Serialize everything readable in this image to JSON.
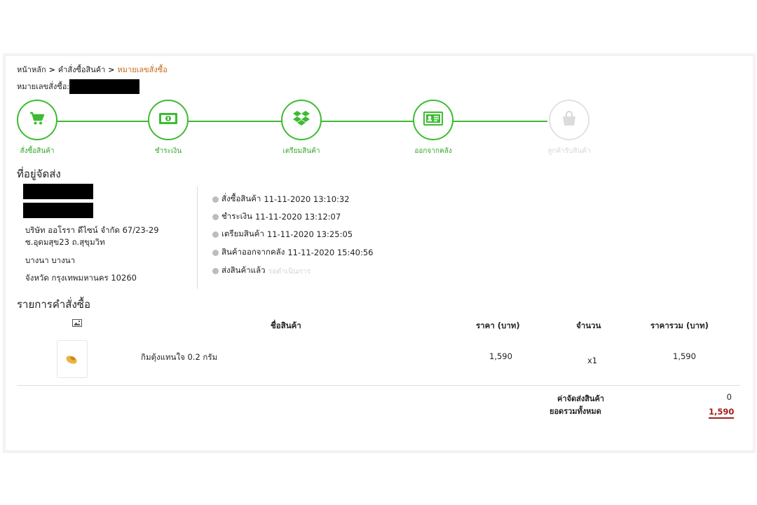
{
  "breadcrumb": {
    "items": [
      "หน้าหลัก",
      "คำสั่งซื้อสินค้า",
      "หมายเลขสั่งซื้อ"
    ],
    "separator": ">"
  },
  "order": {
    "number_label": "หมายเลขสั่งซื้อ:"
  },
  "steps": [
    {
      "label": "สั่งซื้อสินค้า",
      "icon": "cart-icon",
      "active": true
    },
    {
      "label": "ชำระเงิน",
      "icon": "money-icon",
      "active": true
    },
    {
      "label": "เตรียมสินค้า",
      "icon": "box-icon",
      "active": true
    },
    {
      "label": "ออกจากคลัง",
      "icon": "id-card-icon",
      "active": true
    },
    {
      "label": "ลูกค้ารับสินค้า",
      "icon": "bag-icon",
      "active": false
    }
  ],
  "shipping": {
    "heading": "ที่อยู่จัดส่ง",
    "address_lines": [
      "บริษัท ออโรรา ดีไซน์ จำกัด 67/23-29",
      "ซ.อุดมสุข23 ถ.สุขุมวิท",
      "บางนา บางนา",
      "จังหวัด กรุงเทพมหานคร 10260"
    ]
  },
  "timeline": [
    {
      "label": "สั่งซื้อสินค้า",
      "time": "11-11-2020 13:10:32"
    },
    {
      "label": "ชำระเงิน",
      "time": "11-11-2020 13:12:07"
    },
    {
      "label": "เตรียมสินค้า",
      "time": "11-11-2020 13:25:05"
    },
    {
      "label": "สินค้าออกจากคลัง",
      "time": "11-11-2020 15:40:56"
    },
    {
      "label": "ส่งสินค้าแล้ว",
      "time": "รอดำเนินการ"
    }
  ],
  "items_section": {
    "heading": "รายการคำสั่งซื้อ",
    "columns": {
      "image": "image-icon",
      "name": "ชื่อสินค้า",
      "price": "ราคา (บาท)",
      "qty": "จำนวน",
      "total": "ราคารวม (บาท)"
    },
    "rows": [
      {
        "name": "กิมตุ้งแทนใจ 0.2 กรัม",
        "price": "1,590",
        "qty": "x1",
        "total": "1,590"
      }
    ]
  },
  "summary": {
    "shipping_label": "ค่าจัดส่งสินค้า",
    "shipping_value": "0",
    "grand_total_label": "ยอดรวมทั้งหมด",
    "grand_total_value": "1,590"
  },
  "colors": {
    "accent_green": "#3dbb32",
    "breadcrumb_current": "#c46a1a",
    "total_red": "#a02020",
    "inactive": "#e2e2e2"
  }
}
